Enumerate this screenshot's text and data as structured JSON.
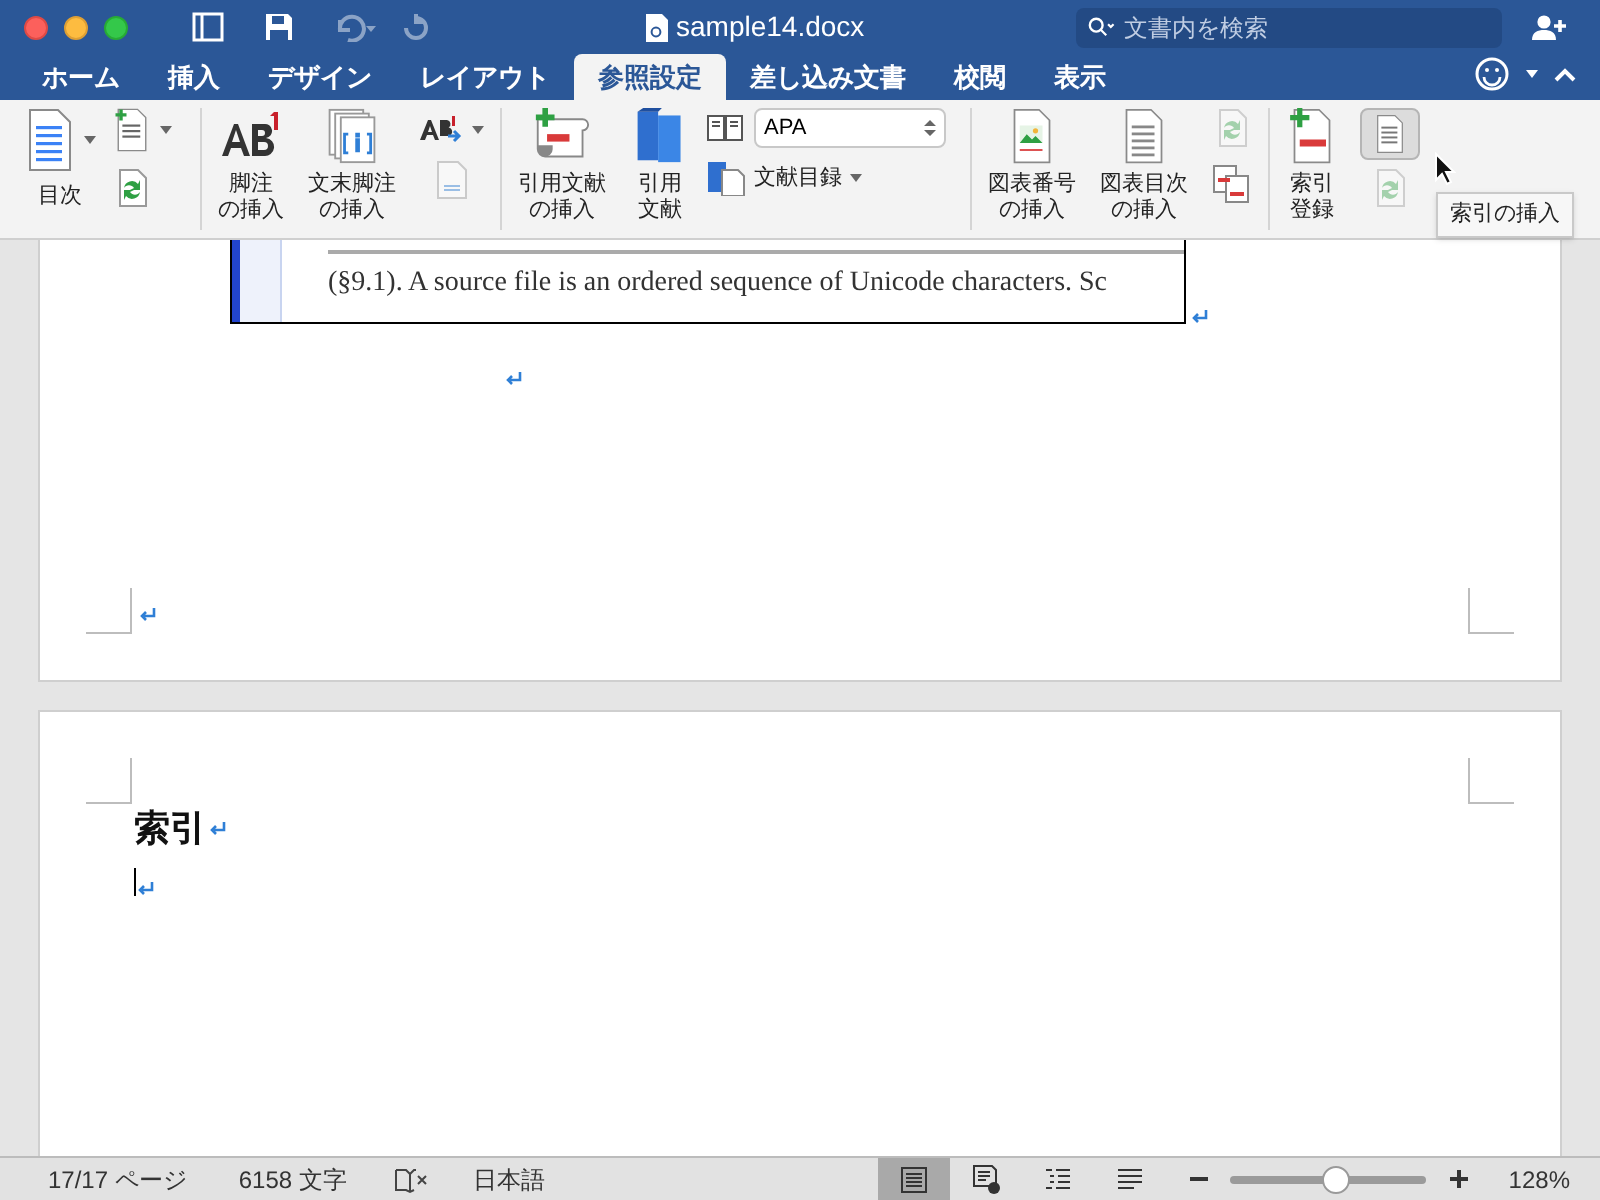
{
  "window": {
    "title": "sample14.docx"
  },
  "search": {
    "placeholder": "文書内を検索"
  },
  "tabs": [
    {
      "label": "ホーム",
      "selected": false
    },
    {
      "label": "挿入",
      "selected": false
    },
    {
      "label": "デザイン",
      "selected": false
    },
    {
      "label": "レイアウト",
      "selected": false
    },
    {
      "label": "参照設定",
      "selected": true
    },
    {
      "label": "差し込み文書",
      "selected": false
    },
    {
      "label": "校閲",
      "selected": false
    },
    {
      "label": "表示",
      "selected": false
    }
  ],
  "ribbon": {
    "toc_label": "目次",
    "footnote_label": [
      "脚注",
      "の挿入"
    ],
    "endnote_label": [
      "文末脚注",
      "の挿入"
    ],
    "citation_label": [
      "引用文献",
      "の挿入"
    ],
    "sources_label": [
      "引用",
      "文献"
    ],
    "style_value": "APA",
    "bibliography_label": "文献目録",
    "caption_label": [
      "図表番号",
      "の挿入"
    ],
    "figures_label": [
      "図表目次",
      "の挿入"
    ],
    "mark_entry_label": [
      "索引",
      "登録"
    ],
    "insert_index_pressed": true
  },
  "tooltip": "索引の挿入",
  "document": {
    "excerpt_line": "(§9.1). A source file is an ordered sequence of Unicode characters. Sc",
    "heading": "索引"
  },
  "status_bar": {
    "page": "17/17 ページ",
    "words": "6158 文字",
    "language": "日本語",
    "views": [
      {
        "kind": "print",
        "selected": true
      },
      {
        "kind": "web",
        "selected": false
      },
      {
        "kind": "outline",
        "selected": false
      },
      {
        "kind": "draft",
        "selected": false
      }
    ],
    "zoom": {
      "level": 0.54,
      "reading": "128%"
    }
  }
}
